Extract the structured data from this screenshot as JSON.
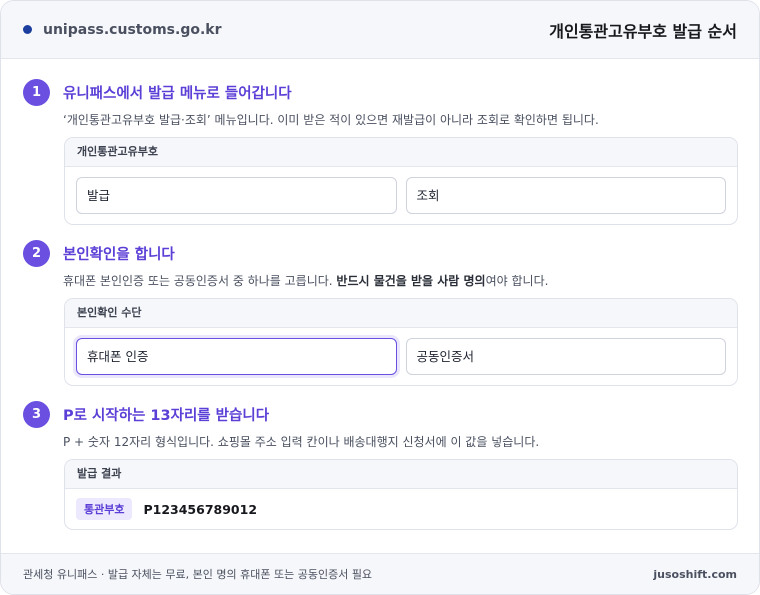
{
  "header": {
    "site": "unipass.customs.go.kr",
    "title": "개인통관고유부호 발급 순서"
  },
  "steps": [
    {
      "number": "1",
      "title": "유니패스에서 발급 메뉴로 들어갑니다",
      "desc": "‘개인통관고유부호 발급·조회’ 메뉴입니다. 이미 받은 적이 있으면 재발급이 아니라 조회로 확인하면 됩니다.",
      "panel_label": "개인통관고유부호",
      "options": [
        "발급",
        "조회"
      ]
    },
    {
      "number": "2",
      "title": "본인확인을 합니다",
      "desc_pre": "휴대폰 본인인증 또는 공동인증서 중 하나를 고릅니다. ",
      "desc_bold": "반드시 물건을 받을 사람 명의",
      "desc_post": "여야 합니다.",
      "panel_label": "본인확인 수단",
      "options": [
        "휴대폰 인증",
        "공동인증서"
      ],
      "selected": "휴대폰 인증"
    },
    {
      "number": "3",
      "title": "P로 시작하는 13자리를 받습니다",
      "desc": "P + 숫자 12자리 형식입니다. 쇼핑몰 주소 입력 칸이나 배송대행지 신청서에 이 값을 넣습니다.",
      "panel_label": "발급 결과",
      "result_tag": "통관부호",
      "result_value": "P123456789012"
    }
  ],
  "footer": {
    "note": "관세청 유니패스 · 발급 자체는 무료, 본인 명의 휴대폰 또는 공동인증서 필요",
    "brand": "jusoshift.com"
  },
  "colors": {
    "accent": "#6b4fe0",
    "site_dot": "#1c3f9f"
  }
}
